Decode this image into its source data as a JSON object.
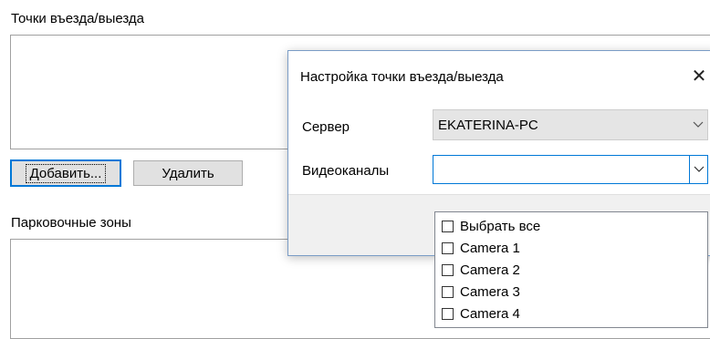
{
  "main": {
    "entry_points_label": "Точки въезда/выезда",
    "add_button": "Добавить...",
    "delete_button": "Удалить",
    "parking_zones_label": "Парковочные зоны"
  },
  "dialog": {
    "title": "Настройка точки въезда/выезда",
    "close_glyph": "✕",
    "server_label": "Сервер",
    "server_value": "EKATERINA-PC",
    "channels_label": "Видеоканалы",
    "channels_value": "",
    "dropdown_items": [
      {
        "label": "Выбрать все",
        "checked": false
      },
      {
        "label": "Camera 1",
        "checked": false
      },
      {
        "label": "Camera 2",
        "checked": false
      },
      {
        "label": "Camera 3",
        "checked": false
      },
      {
        "label": "Camera 4",
        "checked": false
      }
    ]
  },
  "colors": {
    "accent": "#0078d7",
    "button_bg": "#e1e1e1",
    "combo_gray": "#e5e5e5",
    "footer_bg": "#f0f0f0"
  }
}
